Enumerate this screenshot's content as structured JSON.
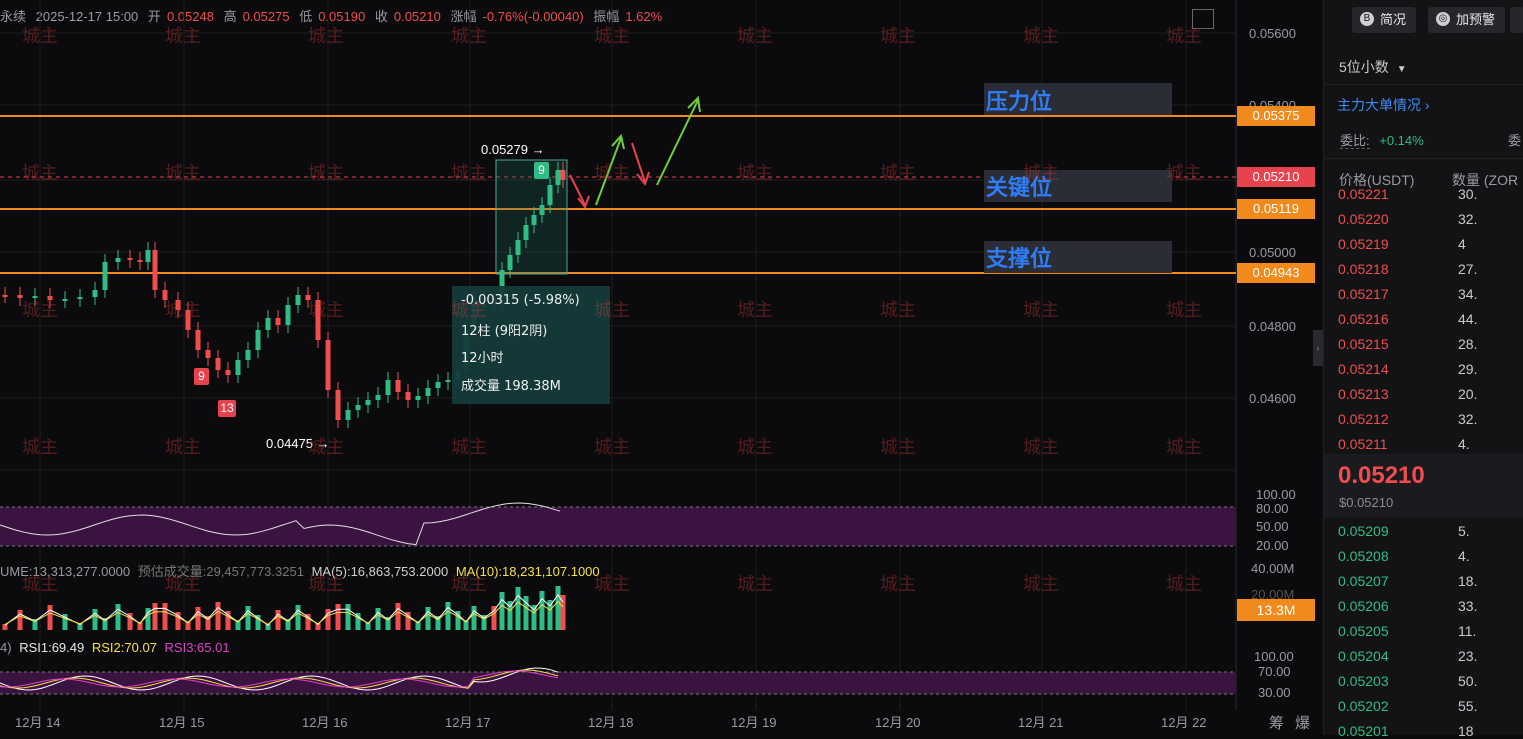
{
  "info": {
    "symbol_suffix": "永续",
    "datetime": "2025-12-17 15:00",
    "open_label": "开",
    "open": "0.05248",
    "high_label": "高",
    "high": "0.05275",
    "low_label": "低",
    "low": "0.05190",
    "close_label": "收",
    "close": "0.05210",
    "change_label": "涨幅",
    "change": "-0.76%(-0.00040)",
    "amp_label": "振幅",
    "amp": "1.62%"
  },
  "price_axis": [
    "0.05600",
    "0.05400",
    "0.05000",
    "0.04800",
    "0.04600"
  ],
  "price_tags": {
    "pressure": "0.05375",
    "current": "0.05210",
    "key": "0.05119",
    "support": "0.04943"
  },
  "levels": {
    "pressure": "压力位",
    "key": "关键位",
    "support": "支撑位"
  },
  "annotations": {
    "high_mark": "0.05279",
    "low_mark": "0.04475",
    "badge_9_top": "9",
    "badge_9_low": "9",
    "badge_13": "13"
  },
  "measure": {
    "change": "-0.00315 (-5.98%)",
    "bars": "12柱 (9阳2阴)",
    "duration": "12小时",
    "volume": "成交量 198.38M"
  },
  "watermark": "城主",
  "indicator_axis_1": [
    "100.00",
    "80.00",
    "50.00",
    "20.00"
  ],
  "volume_line": {
    "vol": "UME:13,313,277.0000",
    "est": "预估成交量:29,457,773.3251",
    "ma5": "MA(5):16,863,753.2000",
    "ma10": "MA(10):18,231,107.1000"
  },
  "volume_axis": [
    "40.00M",
    "20.00M"
  ],
  "volume_tag": "13.3M",
  "rsi_line": {
    "prefix": "4)",
    "rsi1": "RSI1:69.49",
    "rsi2": "RSI2:70.07",
    "rsi3": "RSI3:65.01"
  },
  "rsi_axis": [
    "100.00",
    "70.00",
    "30.00"
  ],
  "dates": [
    "12月 14",
    "12月 15",
    "12月 16",
    "12月 17",
    "12月 18",
    "12月 19",
    "12月 20",
    "12月 21",
    "12月 22"
  ],
  "bottom_right": [
    "筹",
    "爆"
  ],
  "panel": {
    "btn_overview": "简况",
    "btn_alert": "加预警",
    "decimals": "5位小数",
    "big_orders": "主力大单情况",
    "ratio_label": "委比:",
    "ratio_value": "+0.14%",
    "ratio_label2": "委",
    "col_price": "价格(USDT)",
    "col_qty": "数量 (ZOR",
    "last_price": "0.05210",
    "last_usd": "$0.05210",
    "asks": [
      {
        "p": "0.05221",
        "q": "30."
      },
      {
        "p": "0.05220",
        "q": "32."
      },
      {
        "p": "0.05219",
        "q": "4"
      },
      {
        "p": "0.05218",
        "q": "27."
      },
      {
        "p": "0.05217",
        "q": "34."
      },
      {
        "p": "0.05216",
        "q": "44."
      },
      {
        "p": "0.05215",
        "q": "28."
      },
      {
        "p": "0.05214",
        "q": "29."
      },
      {
        "p": "0.05213",
        "q": "20."
      },
      {
        "p": "0.05212",
        "q": "32."
      },
      {
        "p": "0.05211",
        "q": "4."
      }
    ],
    "bids": [
      {
        "p": "0.05209",
        "q": "5."
      },
      {
        "p": "0.05208",
        "q": "4."
      },
      {
        "p": "0.05207",
        "q": "18."
      },
      {
        "p": "0.05206",
        "q": "33."
      },
      {
        "p": "0.05205",
        "q": "11."
      },
      {
        "p": "0.05204",
        "q": "23."
      },
      {
        "p": "0.05203",
        "q": "50."
      },
      {
        "p": "0.05202",
        "q": "55."
      },
      {
        "p": "0.05201",
        "q": "18"
      }
    ]
  },
  "colors": {
    "up": "#2ebd85",
    "down": "#f04d4d",
    "level_line": "#f08a1c",
    "level_text": "#2f7cf6"
  }
}
